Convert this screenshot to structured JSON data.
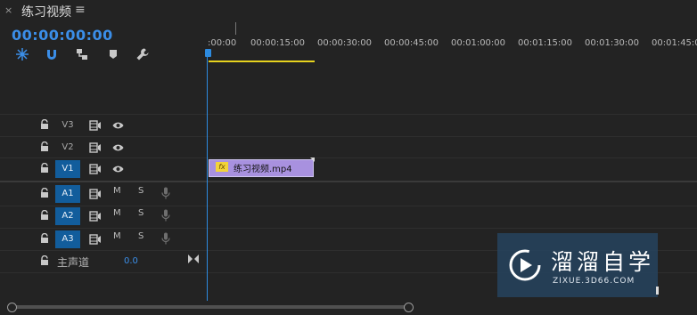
{
  "panel": {
    "close_glyph": "×",
    "title": "练习视频",
    "menu_glyph": "≡"
  },
  "timecode": "00:00:00:00",
  "toolbar": {
    "tools": [
      "snap-icon",
      "magnet-icon",
      "linked-selection-icon",
      "marker-icon",
      "wrench-icon"
    ]
  },
  "ruler": {
    "labels": [
      ":00:00",
      "00:00:15:00",
      "00:00:30:00",
      "00:00:45:00",
      "00:01:00:00",
      "00:01:15:00",
      "00:01:30:00",
      "00:01:45:00"
    ]
  },
  "tracks": {
    "video": [
      {
        "label": "V3",
        "active": false
      },
      {
        "label": "V2",
        "active": false
      },
      {
        "label": "V1",
        "active": true
      }
    ],
    "audio": [
      {
        "label": "A1",
        "active": true,
        "mute": "M",
        "solo": "S"
      },
      {
        "label": "A2",
        "active": true,
        "mute": "M",
        "solo": "S"
      },
      {
        "label": "A3",
        "active": true,
        "mute": "M",
        "solo": "S"
      }
    ],
    "master": {
      "label": "主声道",
      "value": "0.0"
    }
  },
  "clip": {
    "fx": "fx",
    "name": "练习视频.mp4",
    "color": "#a891df"
  },
  "watermark": {
    "title": "溜溜自学",
    "subtitle": "ZIXUE.3D66.COM"
  },
  "colors": {
    "accent": "#3b8ee8",
    "track_active": "#125d9c",
    "in_out_range": "#e7d31e",
    "playhead": "#2d8be0"
  }
}
